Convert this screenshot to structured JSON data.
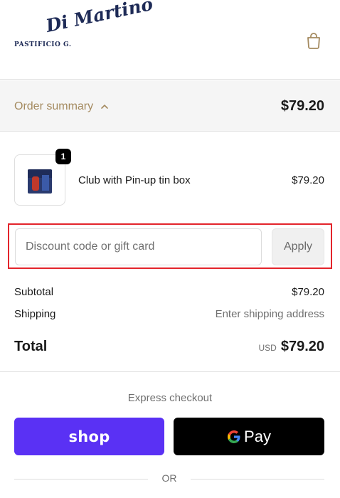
{
  "header": {
    "logo_small": "PASTIFICIO G.",
    "logo_script": "Di Martino",
    "bag_icon": "shopping-bag-icon"
  },
  "summary": {
    "toggle_label": "Order summary",
    "toggle_icon": "chevron-up-icon",
    "total": "$79.20"
  },
  "line_item": {
    "quantity": "1",
    "name": "Club with Pin-up tin box",
    "price": "$79.20"
  },
  "discount": {
    "placeholder": "Discount code or gift card",
    "value": "",
    "apply_label": "Apply"
  },
  "totals": {
    "subtotal_label": "Subtotal",
    "subtotal_value": "$79.20",
    "shipping_label": "Shipping",
    "shipping_value": "Enter shipping address",
    "total_label": "Total",
    "currency": "USD",
    "total_value": "$79.20"
  },
  "express": {
    "title": "Express checkout",
    "shop_label": "shop",
    "gpay_label": "Pay",
    "or_label": "OR"
  },
  "colors": {
    "accent_gold": "#a48a5f",
    "shop_purple": "#5a31f4",
    "highlight_red": "#e3242b"
  }
}
